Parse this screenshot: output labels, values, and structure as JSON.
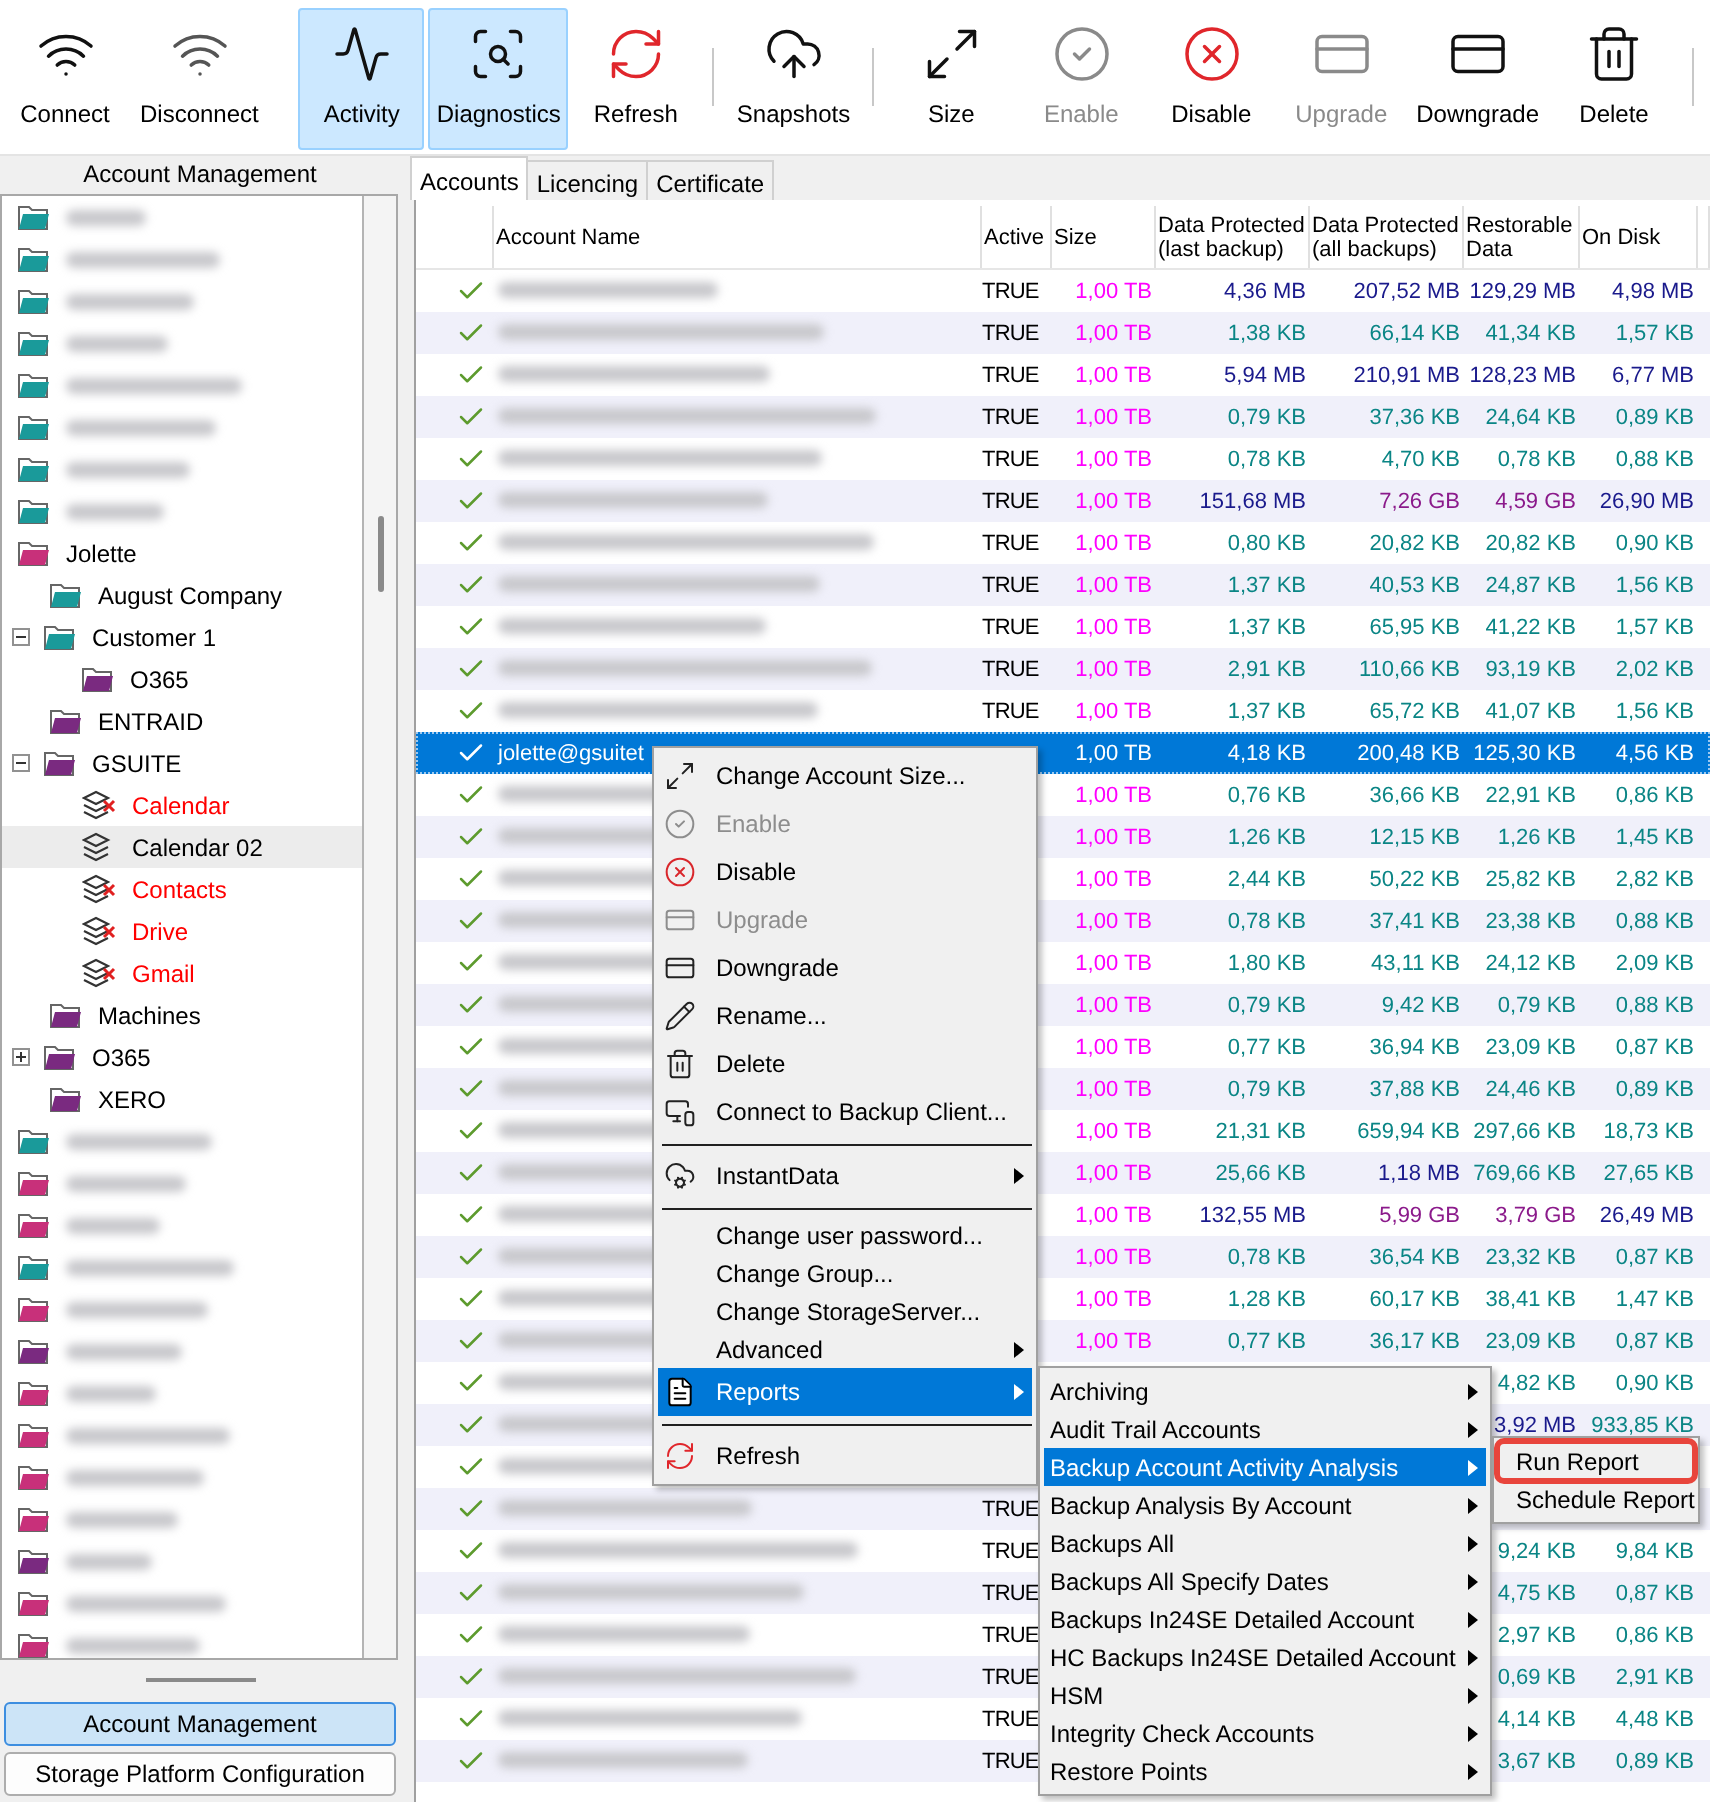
{
  "toolbar": [
    {
      "kind": "button",
      "label": "Connect",
      "selected": false,
      "disabled": false
    },
    {
      "kind": "button",
      "label": "Disconnect",
      "selected": false,
      "disabled": false
    },
    {
      "kind": "spacer"
    },
    {
      "kind": "button",
      "label": "Activity",
      "selected": true,
      "disabled": false
    },
    {
      "kind": "button",
      "label": "Diagnostics",
      "selected": true,
      "disabled": false
    },
    {
      "kind": "button",
      "label": "Refresh",
      "selected": false,
      "disabled": false
    },
    {
      "kind": "separator"
    },
    {
      "kind": "button",
      "label": "Snapshots",
      "selected": false,
      "disabled": false
    },
    {
      "kind": "separator"
    },
    {
      "kind": "button",
      "label": "Size",
      "selected": false,
      "disabled": false
    },
    {
      "kind": "button",
      "label": "Enable",
      "selected": false,
      "disabled": true
    },
    {
      "kind": "button",
      "label": "Disable",
      "selected": false,
      "disabled": false
    },
    {
      "kind": "button",
      "label": "Upgrade",
      "selected": false,
      "disabled": true
    },
    {
      "kind": "button",
      "label": "Downgrade",
      "selected": false,
      "disabled": false
    },
    {
      "kind": "button",
      "label": "Delete",
      "selected": false,
      "disabled": false
    },
    {
      "kind": "separator"
    }
  ],
  "sidebar": {
    "title": "Account Management",
    "tree": [
      {
        "kind": "folder",
        "color": "#1a9a9a",
        "selected": false
      },
      {
        "kind": "folder",
        "color": "#1a9a9a",
        "selected": false
      },
      {
        "kind": "folder",
        "color": "#1a9a9a",
        "selected": false
      },
      {
        "kind": "folder",
        "color": "#1a9a9a",
        "selected": false
      },
      {
        "kind": "folder",
        "color": "#1a9a9a",
        "selected": false
      },
      {
        "kind": "folder",
        "color": "#1a9a9a",
        "selected": false
      },
      {
        "kind": "folder",
        "color": "#1a9a9a",
        "selected": false
      },
      {
        "kind": "folder",
        "color": "#1a9a9a",
        "selected": false
      },
      {
        "kind": "folder",
        "label": "Jolette",
        "color": "#c8307a",
        "selected": false,
        "children": [
          {
            "kind": "folder",
            "label": "August Company",
            "color": "#1a9a9a",
            "selected": false
          },
          {
            "kind": "folder",
            "label": "Customer 1",
            "color": "#1a9a9a",
            "selected": false,
            "expanded": true,
            "children": [
              {
                "kind": "folder",
                "label": "O365",
                "color": "#7a2a80",
                "selected": false
              }
            ]
          },
          {
            "kind": "folder",
            "label": "ENTRAID",
            "color": "#7a2a80",
            "selected": false
          },
          {
            "kind": "folder",
            "label": "GSUITE",
            "color": "#7a2a80",
            "selected": false,
            "expanded": true,
            "children": [
              {
                "kind": "service",
                "label": "Calendar",
                "error": true,
                "selected": false
              },
              {
                "kind": "service",
                "label": "Calendar 02",
                "error": false,
                "selected": true
              },
              {
                "kind": "service",
                "label": "Contacts",
                "error": true,
                "selected": false
              },
              {
                "kind": "service",
                "label": "Drive",
                "error": true,
                "selected": false
              },
              {
                "kind": "service",
                "label": "Gmail",
                "error": true,
                "selected": false
              }
            ]
          },
          {
            "kind": "folder",
            "label": "Machines",
            "color": "#7a2a80",
            "selected": false
          },
          {
            "kind": "folder",
            "label": "O365",
            "color": "#7a2a80",
            "selected": false,
            "expanded": false
          },
          {
            "kind": "folder",
            "label": "XERO",
            "color": "#7a2a80",
            "selected": false
          }
        ]
      },
      {
        "kind": "folder",
        "color": "#1a9a9a",
        "selected": false
      },
      {
        "kind": "folder",
        "color": "#c8307a",
        "selected": false
      },
      {
        "kind": "folder",
        "color": "#c8307a",
        "selected": false
      },
      {
        "kind": "folder",
        "color": "#1a9a9a",
        "selected": false
      },
      {
        "kind": "folder",
        "color": "#c8307a",
        "selected": false
      },
      {
        "kind": "folder",
        "color": "#7a2a80",
        "selected": false
      },
      {
        "kind": "folder",
        "color": "#c8307a",
        "selected": false
      },
      {
        "kind": "folder",
        "color": "#c8307a",
        "selected": false
      },
      {
        "kind": "folder",
        "color": "#c8307a",
        "selected": false
      },
      {
        "kind": "folder",
        "color": "#c8307a",
        "selected": false
      },
      {
        "kind": "folder",
        "color": "#7a2a80",
        "selected": false
      },
      {
        "kind": "folder",
        "color": "#c8307a",
        "selected": false
      },
      {
        "kind": "folder",
        "color": "#c8307a",
        "selected": false
      }
    ],
    "nav_buttons": [
      {
        "label": "Account Management",
        "selected": true
      },
      {
        "label": "Storage Platform Configuration",
        "selected": false
      }
    ]
  },
  "tabs": [
    {
      "label": "Accounts",
      "selected": true
    },
    {
      "label": "Licencing",
      "selected": false
    },
    {
      "label": "Certificate",
      "selected": false
    }
  ],
  "table": {
    "columns": [
      "Account Name",
      "Active",
      "Size",
      "Data Protected (last backup)",
      "Data Protected (all backups)",
      "Restorable Data",
      "On Disk"
    ],
    "rows": [
      {
        "ok": true,
        "selected": false,
        "cells": [
          null,
          {
            "text": "TRUE",
            "color": "#000000"
          },
          {
            "text": "1,00 TB",
            "color": "#ff00ff"
          },
          {
            "text": "4,36 MB",
            "color": "#1a1a8c"
          },
          {
            "text": "207,52 MB",
            "color": "#1a1a8c"
          },
          {
            "text": "129,29 MB",
            "color": "#1a1a8c"
          },
          {
            "text": "4,98 MB",
            "color": "#1a1a8c"
          }
        ]
      },
      {
        "ok": true,
        "selected": false,
        "cells": [
          null,
          {
            "text": "TRUE",
            "color": "#000000"
          },
          {
            "text": "1,00 TB",
            "color": "#ff00ff"
          },
          {
            "text": "1,38 KB",
            "color": "#0a8585"
          },
          {
            "text": "66,14 KB",
            "color": "#0a8585"
          },
          {
            "text": "41,34 KB",
            "color": "#0a8585"
          },
          {
            "text": "1,57 KB",
            "color": "#0a8585"
          }
        ]
      },
      {
        "ok": true,
        "selected": false,
        "cells": [
          null,
          {
            "text": "TRUE",
            "color": "#000000"
          },
          {
            "text": "1,00 TB",
            "color": "#ff00ff"
          },
          {
            "text": "5,94 MB",
            "color": "#1a1a8c"
          },
          {
            "text": "210,91 MB",
            "color": "#1a1a8c"
          },
          {
            "text": "128,23 MB",
            "color": "#1a1a8c"
          },
          {
            "text": "6,77 MB",
            "color": "#1a1a8c"
          }
        ]
      },
      {
        "ok": true,
        "selected": false,
        "cells": [
          null,
          {
            "text": "TRUE",
            "color": "#000000"
          },
          {
            "text": "1,00 TB",
            "color": "#ff00ff"
          },
          {
            "text": "0,79 KB",
            "color": "#0a8585"
          },
          {
            "text": "37,36 KB",
            "color": "#0a8585"
          },
          {
            "text": "24,64 KB",
            "color": "#0a8585"
          },
          {
            "text": "0,89 KB",
            "color": "#0a8585"
          }
        ]
      },
      {
        "ok": true,
        "selected": false,
        "cells": [
          null,
          {
            "text": "TRUE",
            "color": "#000000"
          },
          {
            "text": "1,00 TB",
            "color": "#ff00ff"
          },
          {
            "text": "0,78 KB",
            "color": "#0a8585"
          },
          {
            "text": "4,70 KB",
            "color": "#0a8585"
          },
          {
            "text": "0,78 KB",
            "color": "#0a8585"
          },
          {
            "text": "0,88 KB",
            "color": "#0a8585"
          }
        ]
      },
      {
        "ok": true,
        "selected": false,
        "cells": [
          null,
          {
            "text": "TRUE",
            "color": "#000000"
          },
          {
            "text": "1,00 TB",
            "color": "#ff00ff"
          },
          {
            "text": "151,68 MB",
            "color": "#1a1a8c"
          },
          {
            "text": "7,26 GB",
            "color": "#8b1a8b"
          },
          {
            "text": "4,59 GB",
            "color": "#8b1a8b"
          },
          {
            "text": "26,90 MB",
            "color": "#1a1a8c"
          }
        ]
      },
      {
        "ok": true,
        "selected": false,
        "cells": [
          null,
          {
            "text": "TRUE",
            "color": "#000000"
          },
          {
            "text": "1,00 TB",
            "color": "#ff00ff"
          },
          {
            "text": "0,80 KB",
            "color": "#0a8585"
          },
          {
            "text": "20,82 KB",
            "color": "#0a8585"
          },
          {
            "text": "20,82 KB",
            "color": "#0a8585"
          },
          {
            "text": "0,90 KB",
            "color": "#0a8585"
          }
        ]
      },
      {
        "ok": true,
        "selected": false,
        "cells": [
          null,
          {
            "text": "TRUE",
            "color": "#000000"
          },
          {
            "text": "1,00 TB",
            "color": "#ff00ff"
          },
          {
            "text": "1,37 KB",
            "color": "#0a8585"
          },
          {
            "text": "40,53 KB",
            "color": "#0a8585"
          },
          {
            "text": "24,87 KB",
            "color": "#0a8585"
          },
          {
            "text": "1,56 KB",
            "color": "#0a8585"
          }
        ]
      },
      {
        "ok": true,
        "selected": false,
        "cells": [
          null,
          {
            "text": "TRUE",
            "color": "#000000"
          },
          {
            "text": "1,00 TB",
            "color": "#ff00ff"
          },
          {
            "text": "1,37 KB",
            "color": "#0a8585"
          },
          {
            "text": "65,95 KB",
            "color": "#0a8585"
          },
          {
            "text": "41,22 KB",
            "color": "#0a8585"
          },
          {
            "text": "1,57 KB",
            "color": "#0a8585"
          }
        ]
      },
      {
        "ok": true,
        "selected": false,
        "cells": [
          null,
          {
            "text": "TRUE",
            "color": "#000000"
          },
          {
            "text": "1,00 TB",
            "color": "#ff00ff"
          },
          {
            "text": "2,91 KB",
            "color": "#0a8585"
          },
          {
            "text": "110,66 KB",
            "color": "#0a8585"
          },
          {
            "text": "93,19 KB",
            "color": "#0a8585"
          },
          {
            "text": "2,02 KB",
            "color": "#0a8585"
          }
        ]
      },
      {
        "ok": true,
        "selected": false,
        "cells": [
          null,
          {
            "text": "TRUE",
            "color": "#000000"
          },
          {
            "text": "1,00 TB",
            "color": "#ff00ff"
          },
          {
            "text": "1,37 KB",
            "color": "#0a8585"
          },
          {
            "text": "65,72 KB",
            "color": "#0a8585"
          },
          {
            "text": "41,07 KB",
            "color": "#0a8585"
          },
          {
            "text": "1,56 KB",
            "color": "#0a8585"
          }
        ]
      },
      {
        "ok": true,
        "selected": true,
        "cells": [
          {
            "text": "jolette@gsuitet",
            "color": "#ffffff"
          },
          null,
          {
            "text": "1,00 TB",
            "color": "#ffffff"
          },
          {
            "text": "4,18 KB",
            "color": "#ffffff"
          },
          {
            "text": "200,48 KB",
            "color": "#ffffff"
          },
          {
            "text": "125,30 KB",
            "color": "#ffffff"
          },
          {
            "text": "4,56 KB",
            "color": "#ffffff"
          }
        ]
      },
      {
        "ok": true,
        "selected": false,
        "cells": [
          null,
          null,
          {
            "text": "1,00 TB",
            "color": "#ff00ff"
          },
          {
            "text": "0,76 KB",
            "color": "#0a8585"
          },
          {
            "text": "36,66 KB",
            "color": "#0a8585"
          },
          {
            "text": "22,91 KB",
            "color": "#0a8585"
          },
          {
            "text": "0,86 KB",
            "color": "#0a8585"
          }
        ]
      },
      {
        "ok": true,
        "selected": false,
        "cells": [
          null,
          null,
          {
            "text": "1,00 TB",
            "color": "#ff00ff"
          },
          {
            "text": "1,26 KB",
            "color": "#0a8585"
          },
          {
            "text": "12,15 KB",
            "color": "#0a8585"
          },
          {
            "text": "1,26 KB",
            "color": "#0a8585"
          },
          {
            "text": "1,45 KB",
            "color": "#0a8585"
          }
        ]
      },
      {
        "ok": true,
        "selected": false,
        "cells": [
          null,
          null,
          {
            "text": "1,00 TB",
            "color": "#ff00ff"
          },
          {
            "text": "2,44 KB",
            "color": "#0a8585"
          },
          {
            "text": "50,22 KB",
            "color": "#0a8585"
          },
          {
            "text": "25,82 KB",
            "color": "#0a8585"
          },
          {
            "text": "2,82 KB",
            "color": "#0a8585"
          }
        ]
      },
      {
        "ok": true,
        "selected": false,
        "cells": [
          null,
          null,
          {
            "text": "1,00 TB",
            "color": "#ff00ff"
          },
          {
            "text": "0,78 KB",
            "color": "#0a8585"
          },
          {
            "text": "37,41 KB",
            "color": "#0a8585"
          },
          {
            "text": "23,38 KB",
            "color": "#0a8585"
          },
          {
            "text": "0,88 KB",
            "color": "#0a8585"
          }
        ]
      },
      {
        "ok": true,
        "selected": false,
        "cells": [
          null,
          null,
          {
            "text": "1,00 TB",
            "color": "#ff00ff"
          },
          {
            "text": "1,80 KB",
            "color": "#0a8585"
          },
          {
            "text": "43,11 KB",
            "color": "#0a8585"
          },
          {
            "text": "24,12 KB",
            "color": "#0a8585"
          },
          {
            "text": "2,09 KB",
            "color": "#0a8585"
          }
        ]
      },
      {
        "ok": true,
        "selected": false,
        "cells": [
          null,
          null,
          {
            "text": "1,00 TB",
            "color": "#ff00ff"
          },
          {
            "text": "0,79 KB",
            "color": "#0a8585"
          },
          {
            "text": "9,42 KB",
            "color": "#0a8585"
          },
          {
            "text": "0,79 KB",
            "color": "#0a8585"
          },
          {
            "text": "0,88 KB",
            "color": "#0a8585"
          }
        ]
      },
      {
        "ok": true,
        "selected": false,
        "cells": [
          null,
          null,
          {
            "text": "1,00 TB",
            "color": "#ff00ff"
          },
          {
            "text": "0,77 KB",
            "color": "#0a8585"
          },
          {
            "text": "36,94 KB",
            "color": "#0a8585"
          },
          {
            "text": "23,09 KB",
            "color": "#0a8585"
          },
          {
            "text": "0,87 KB",
            "color": "#0a8585"
          }
        ]
      },
      {
        "ok": true,
        "selected": false,
        "cells": [
          null,
          null,
          {
            "text": "1,00 TB",
            "color": "#ff00ff"
          },
          {
            "text": "0,79 KB",
            "color": "#0a8585"
          },
          {
            "text": "37,88 KB",
            "color": "#0a8585"
          },
          {
            "text": "24,46 KB",
            "color": "#0a8585"
          },
          {
            "text": "0,89 KB",
            "color": "#0a8585"
          }
        ]
      },
      {
        "ok": true,
        "selected": false,
        "cells": [
          null,
          null,
          {
            "text": "1,00 TB",
            "color": "#ff00ff"
          },
          {
            "text": "21,31 KB",
            "color": "#0a8585"
          },
          {
            "text": "659,94 KB",
            "color": "#0a8585"
          },
          {
            "text": "297,66 KB",
            "color": "#0a8585"
          },
          {
            "text": "18,73 KB",
            "color": "#0a8585"
          }
        ]
      },
      {
        "ok": true,
        "selected": false,
        "cells": [
          null,
          null,
          {
            "text": "1,00 TB",
            "color": "#ff00ff"
          },
          {
            "text": "25,66 KB",
            "color": "#0a8585"
          },
          {
            "text": "1,18 MB",
            "color": "#1a1a8c"
          },
          {
            "text": "769,66 KB",
            "color": "#0a8585"
          },
          {
            "text": "27,65 KB",
            "color": "#0a8585"
          }
        ]
      },
      {
        "ok": true,
        "selected": false,
        "cells": [
          null,
          null,
          {
            "text": "1,00 TB",
            "color": "#ff00ff"
          },
          {
            "text": "132,55 MB",
            "color": "#1a1a8c"
          },
          {
            "text": "5,99 GB",
            "color": "#8b1a8b"
          },
          {
            "text": "3,79 GB",
            "color": "#8b1a8b"
          },
          {
            "text": "26,49 MB",
            "color": "#1a1a8c"
          }
        ]
      },
      {
        "ok": true,
        "selected": false,
        "cells": [
          null,
          null,
          {
            "text": "1,00 TB",
            "color": "#ff00ff"
          },
          {
            "text": "0,78 KB",
            "color": "#0a8585"
          },
          {
            "text": "36,54 KB",
            "color": "#0a8585"
          },
          {
            "text": "23,32 KB",
            "color": "#0a8585"
          },
          {
            "text": "0,87 KB",
            "color": "#0a8585"
          }
        ]
      },
      {
        "ok": true,
        "selected": false,
        "cells": [
          null,
          null,
          {
            "text": "1,00 TB",
            "color": "#ff00ff"
          },
          {
            "text": "1,28 KB",
            "color": "#0a8585"
          },
          {
            "text": "60,17 KB",
            "color": "#0a8585"
          },
          {
            "text": "38,41 KB",
            "color": "#0a8585"
          },
          {
            "text": "1,47 KB",
            "color": "#0a8585"
          }
        ]
      },
      {
        "ok": true,
        "selected": false,
        "cells": [
          null,
          null,
          {
            "text": "1,00 TB",
            "color": "#ff00ff"
          },
          {
            "text": "0,77 KB",
            "color": "#0a8585"
          },
          {
            "text": "36,17 KB",
            "color": "#0a8585"
          },
          {
            "text": "23,09 KB",
            "color": "#0a8585"
          },
          {
            "text": "0,87 KB",
            "color": "#0a8585"
          }
        ]
      },
      {
        "ok": true,
        "selected": false,
        "cells": [
          null,
          null,
          null,
          null,
          null,
          {
            "text": "4,82 KB",
            "color": "#0a8585"
          },
          {
            "text": "0,90 KB",
            "color": "#0a8585"
          }
        ]
      },
      {
        "ok": true,
        "selected": false,
        "cells": [
          null,
          null,
          null,
          null,
          null,
          {
            "text": "3,92 MB",
            "color": "#1a1a8c"
          },
          {
            "text": "933,85 KB",
            "color": "#0a8585"
          }
        ]
      },
      {
        "ok": true,
        "selected": false,
        "cells": [
          null,
          null,
          null,
          null,
          null,
          null,
          null
        ]
      },
      {
        "ok": true,
        "selected": false,
        "cells": [
          null,
          {
            "text": "TRUE",
            "color": "#000000"
          },
          null,
          null,
          null,
          null,
          null
        ]
      },
      {
        "ok": true,
        "selected": false,
        "cells": [
          null,
          {
            "text": "TRUE",
            "color": "#000000"
          },
          null,
          null,
          null,
          {
            "text": "9,24 KB",
            "color": "#0a8585"
          },
          {
            "text": "9,84 KB",
            "color": "#0a8585"
          }
        ]
      },
      {
        "ok": true,
        "selected": false,
        "cells": [
          null,
          {
            "text": "TRUE",
            "color": "#000000"
          },
          null,
          null,
          null,
          {
            "text": "4,75 KB",
            "color": "#0a8585"
          },
          {
            "text": "0,87 KB",
            "color": "#0a8585"
          }
        ]
      },
      {
        "ok": true,
        "selected": false,
        "cells": [
          null,
          {
            "text": "TRUE",
            "color": "#000000"
          },
          null,
          null,
          null,
          {
            "text": "2,97 KB",
            "color": "#0a8585"
          },
          {
            "text": "0,86 KB",
            "color": "#0a8585"
          }
        ]
      },
      {
        "ok": true,
        "selected": false,
        "cells": [
          null,
          {
            "text": "TRUE",
            "color": "#000000"
          },
          null,
          null,
          null,
          {
            "text": "0,69 KB",
            "color": "#0a8585"
          },
          {
            "text": "2,91 KB",
            "color": "#0a8585"
          }
        ]
      },
      {
        "ok": true,
        "selected": false,
        "cells": [
          null,
          {
            "text": "TRUE",
            "color": "#000000"
          },
          null,
          null,
          null,
          {
            "text": "4,14 KB",
            "color": "#0a8585"
          },
          {
            "text": "4,48 KB",
            "color": "#0a8585"
          }
        ]
      },
      {
        "ok": true,
        "selected": false,
        "cells": [
          null,
          {
            "text": "TRUE",
            "color": "#000000"
          },
          null,
          null,
          null,
          {
            "text": "3,67 KB",
            "color": "#0a8585"
          },
          {
            "text": "0,89 KB",
            "color": "#0a8585"
          }
        ]
      }
    ]
  },
  "context_menu": {
    "items": [
      {
        "kind": "item",
        "label": "Change Account Size...",
        "disabled": false,
        "submenu": false,
        "selected": false
      },
      {
        "kind": "item",
        "label": "Enable",
        "disabled": true,
        "submenu": false,
        "selected": false
      },
      {
        "kind": "item",
        "label": "Disable",
        "disabled": false,
        "submenu": false,
        "selected": false
      },
      {
        "kind": "item",
        "label": "Upgrade",
        "disabled": true,
        "submenu": false,
        "selected": false
      },
      {
        "kind": "item",
        "label": "Downgrade",
        "disabled": false,
        "submenu": false,
        "selected": false
      },
      {
        "kind": "item",
        "label": "Rename...",
        "disabled": false,
        "submenu": false,
        "selected": false
      },
      {
        "kind": "item",
        "label": "Delete",
        "disabled": false,
        "submenu": false,
        "selected": false
      },
      {
        "kind": "item",
        "label": "Connect to Backup Client...",
        "disabled": false,
        "submenu": false,
        "selected": false
      },
      {
        "kind": "separator"
      },
      {
        "kind": "item",
        "label": "InstantData",
        "disabled": false,
        "submenu": true,
        "selected": false
      },
      {
        "kind": "separator"
      },
      {
        "kind": "item",
        "label": "Change user password...",
        "disabled": false,
        "submenu": false,
        "selected": false
      },
      {
        "kind": "item",
        "label": "Change Group...",
        "disabled": false,
        "submenu": false,
        "selected": false
      },
      {
        "kind": "item",
        "label": "Change StorageServer...",
        "disabled": false,
        "submenu": false,
        "selected": false
      },
      {
        "kind": "item",
        "label": "Advanced",
        "disabled": false,
        "submenu": true,
        "selected": false
      },
      {
        "kind": "item",
        "label": "Reports",
        "disabled": false,
        "submenu": true,
        "selected": true
      },
      {
        "kind": "separator"
      },
      {
        "kind": "item",
        "label": "Refresh",
        "disabled": false,
        "submenu": false,
        "selected": false
      }
    ]
  },
  "reports_menu": {
    "items": [
      {
        "label": "Archiving",
        "submenu": true,
        "selected": false
      },
      {
        "label": "Audit Trail Accounts",
        "submenu": true,
        "selected": false
      },
      {
        "label": "Backup Account Activity Analysis",
        "submenu": true,
        "selected": true
      },
      {
        "label": "Backup Analysis By Account",
        "submenu": true,
        "selected": false
      },
      {
        "label": "Backups All",
        "submenu": true,
        "selected": false
      },
      {
        "label": "Backups All Specify Dates",
        "submenu": true,
        "selected": false
      },
      {
        "label": "Backups In24SE Detailed Account",
        "submenu": true,
        "selected": false
      },
      {
        "label": "HC Backups In24SE Detailed Account",
        "submenu": true,
        "selected": false
      },
      {
        "label": "HSM",
        "submenu": true,
        "selected": false
      },
      {
        "label": "Integrity Check Accounts",
        "submenu": true,
        "selected": false
      },
      {
        "label": "Restore Points",
        "submenu": true,
        "selected": false
      }
    ]
  },
  "report_actions_menu": {
    "items": [
      {
        "label": "Run Report",
        "selected": false,
        "annotated": true
      },
      {
        "label": "Schedule Report",
        "selected": false,
        "annotated": false
      }
    ]
  }
}
